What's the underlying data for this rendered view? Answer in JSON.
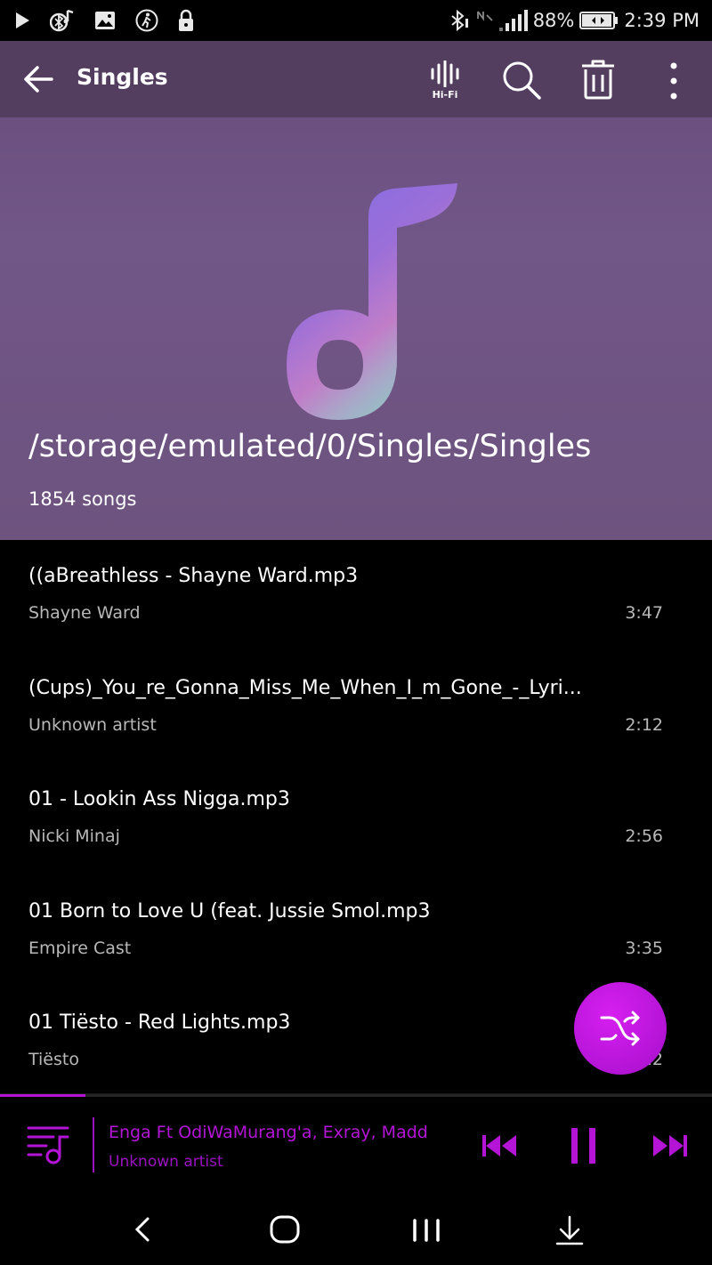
{
  "status_bar": {
    "battery": "88%",
    "time": "2:39 PM",
    "icons_left": [
      "play-icon",
      "bluetooth-music-icon",
      "image-icon",
      "walking-icon",
      "lock-icon"
    ],
    "icons_right": [
      "bluetooth-icon",
      "no-signal-icon",
      "signal-icon",
      "battery-icon"
    ]
  },
  "app_bar": {
    "title": "Singles",
    "hifi_label": "Hi-Fi",
    "actions": [
      "back-arrow-icon",
      "hifi-icon",
      "search-icon",
      "trash-icon",
      "more-vert-icon"
    ]
  },
  "hero": {
    "folder_path": "/storage/emulated/0/Singles/Singles",
    "song_count": "1854 songs",
    "art_icon": "music-note-icon"
  },
  "songs": [
    {
      "title": "((aBreathless - Shayne Ward.mp3",
      "artist": "Shayne Ward",
      "duration": "3:47"
    },
    {
      "title": "(Cups)_You_re_Gonna_Miss_Me_When_I_m_Gone_-_Lyri...",
      "artist": "Unknown artist",
      "duration": "2:12"
    },
    {
      "title": "01 - Lookin Ass Nigga.mp3",
      "artist": "Nicki Minaj",
      "duration": "2:56"
    },
    {
      "title": "01 Born to Love U (feat. Jussie Smol.mp3",
      "artist": "Empire Cast",
      "duration": "3:35"
    },
    {
      "title": "01 Tiësto - Red Lights.mp3",
      "artist": "Tiësto",
      "duration": "4:22"
    }
  ],
  "shuffle_fab": {
    "icon": "shuffle-icon"
  },
  "mini_player": {
    "title": "Enga Ft OdiWaMurang'a, Exray, Madd",
    "artist": "Unknown artist",
    "progress": 0.12,
    "accent_color": "#b414d6"
  },
  "nav_bar": {
    "icons": [
      "nav-back-icon",
      "nav-home-icon",
      "nav-recents-icon",
      "nav-down-icon"
    ]
  }
}
